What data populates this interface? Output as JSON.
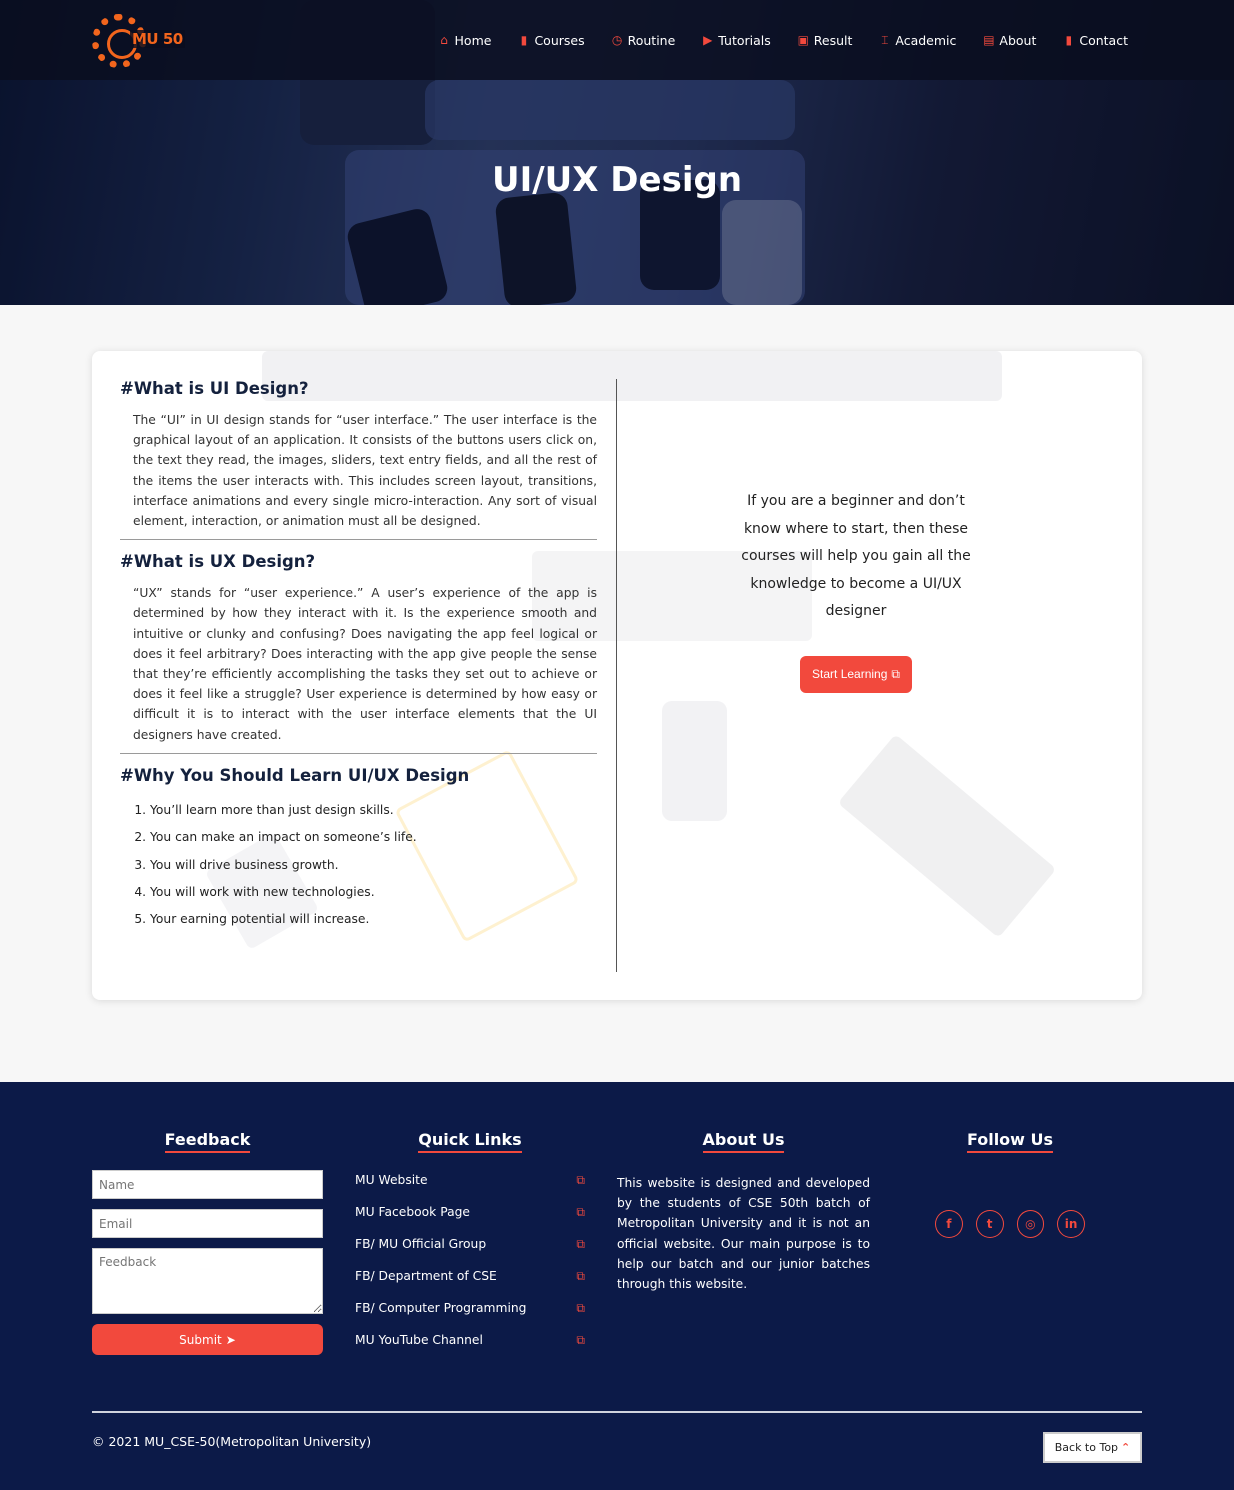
{
  "brand": {
    "logo_text": "MU 50"
  },
  "nav": {
    "items": [
      {
        "label": "Home",
        "icon": "home-icon",
        "glyph": "⌂"
      },
      {
        "label": "Courses",
        "icon": "book-icon",
        "glyph": "▮"
      },
      {
        "label": "Routine",
        "icon": "clock-icon",
        "glyph": "◷"
      },
      {
        "label": "Tutorials",
        "icon": "video-icon",
        "glyph": "▶"
      },
      {
        "label": "Result",
        "icon": "result-icon",
        "glyph": "▣"
      },
      {
        "label": "Academic",
        "icon": "building-icon",
        "glyph": "⌶"
      },
      {
        "label": "About",
        "icon": "id-card-icon",
        "glyph": "▤"
      },
      {
        "label": "Contact",
        "icon": "contact-icon",
        "glyph": "▮"
      }
    ]
  },
  "hero": {
    "title": "UI/UX Design"
  },
  "content": {
    "ui_heading": "#What is UI Design?",
    "ui_text": "The “UI” in UI design stands for “user interface.” The user interface is the graphical layout of an application. It consists of the buttons users click on, the text they read, the images, sliders, text entry fields, and all the rest of the items the user interacts with. This includes screen layout, transitions, interface animations and every single micro-interaction. Any sort of visual element, interaction, or animation must all be designed.",
    "ux_heading": "#What is UX Design?",
    "ux_text": "“UX” stands for “user experience.” A user’s experience of the app is determined by how they interact with it. Is the experience smooth and intuitive or clunky and confusing? Does navigating the app feel logical or does it feel arbitrary? Does interacting with the app give people the sense that they’re efficiently accomplishing the tasks they set out to achieve or does it feel like a struggle? User experience is determined by how easy or difficult it is to interact with the user interface elements that the UI designers have created.",
    "why_heading": "#Why You Should Learn UI/UX Design",
    "why_list": [
      "You’ll learn more than just design skills.",
      "You can make an impact on someone’s life.",
      "You will drive business growth.",
      "You will work with new technologies.",
      "Your earning potential will increase."
    ],
    "cta_text": "If you are a beginner and don’t know where to start, then these courses will help you gain all the knowledge to become a UI/UX designer",
    "cta_button": "Start Learning"
  },
  "footer": {
    "feedback_title": "Feedback",
    "name_placeholder": "Name",
    "email_placeholder": "Email",
    "feedback_placeholder": "Feedback",
    "submit_label": "Submit",
    "quick_links_title": "Quick Links",
    "quick_links": [
      "MU Website",
      "MU Facebook Page",
      "FB/ MU Official Group",
      "FB/ Department of CSE",
      "FB/ Computer Programming",
      "MU YouTube Channel"
    ],
    "about_title": "About Us",
    "about_text": "This website is designed and developed by the students of CSE 50th batch of Metropolitan University and it is not an official website. Our main purpose is to help our batch and our junior batches through this website.",
    "follow_title": "Follow Us",
    "socials": [
      {
        "name": "facebook-icon",
        "glyph": "f"
      },
      {
        "name": "twitter-icon",
        "glyph": "t"
      },
      {
        "name": "instagram-icon",
        "glyph": "◎"
      },
      {
        "name": "linkedin-icon",
        "glyph": "in"
      }
    ],
    "copyright": "© 2021 MU_CSE-50(Metropolitan University)",
    "back_to_top": "Back to Top"
  },
  "colors": {
    "accent": "#f2493d",
    "footer_bg": "#0c1a48",
    "logo": "#f2651d"
  }
}
